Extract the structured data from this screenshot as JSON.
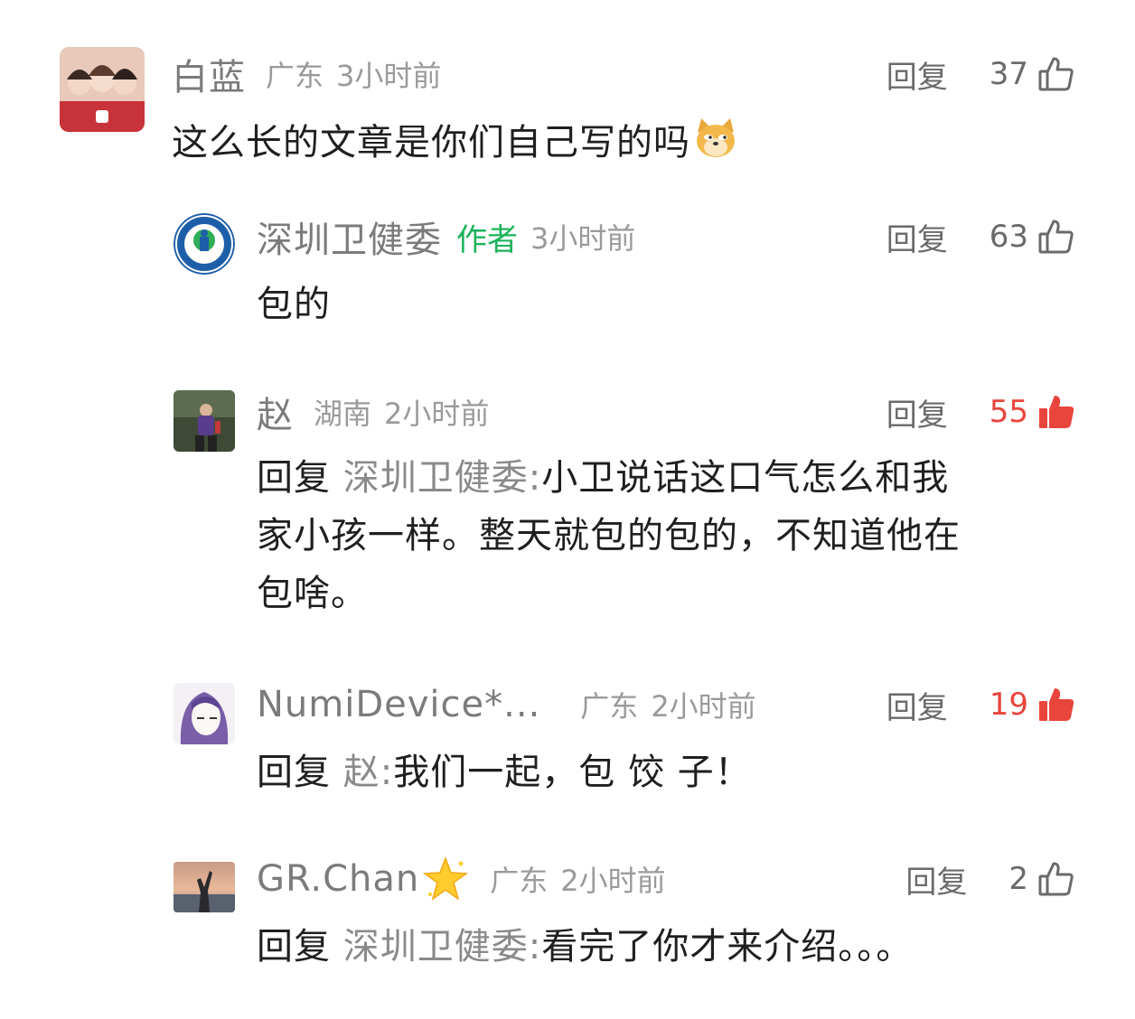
{
  "comments": [
    {
      "username": "白蓝",
      "location": "广东",
      "time": "3小时前",
      "reply_label": "回复",
      "likes": "37",
      "liked": false,
      "text": "这么长的文章是你们自己写的吗",
      "emoji": "doge-emoji"
    },
    {
      "username": "深圳卫健委",
      "author_tag": "作者",
      "time": "3小时前",
      "reply_label": "回复",
      "likes": "63",
      "liked": false,
      "text": "包的"
    },
    {
      "username": "赵",
      "location": "湖南",
      "time": "2小时前",
      "reply_label": "回复",
      "likes": "55",
      "liked": true,
      "prefix": "回复",
      "reply_to": "深圳卫健委",
      "colon": ":",
      "text_line1": "小卫说话这口气怎么和我",
      "text_line2": "家小孩一样。整天就包的包的，不知道他在",
      "text_line3": "包啥。"
    },
    {
      "username": "NumiDevice*...",
      "location": "广东",
      "time": "2小时前",
      "reply_label": "回复",
      "likes": "19",
      "liked": true,
      "prefix": "回复",
      "reply_to": "赵",
      "colon": ":",
      "text": "我们一起，包 饺 子！"
    },
    {
      "username": "GR.Chan",
      "username_emoji": "star-emoji",
      "location": "广东",
      "time": "2小时前",
      "reply_label": "回复",
      "likes": "2",
      "liked": false,
      "prefix": "回复",
      "reply_to": "深圳卫健委",
      "colon": ":",
      "text": "看完了你才来介绍。。。"
    }
  ],
  "colors": {
    "liked": "#e8453c",
    "author_tag": "#1bb35a",
    "meta": "#9a9a9a"
  }
}
